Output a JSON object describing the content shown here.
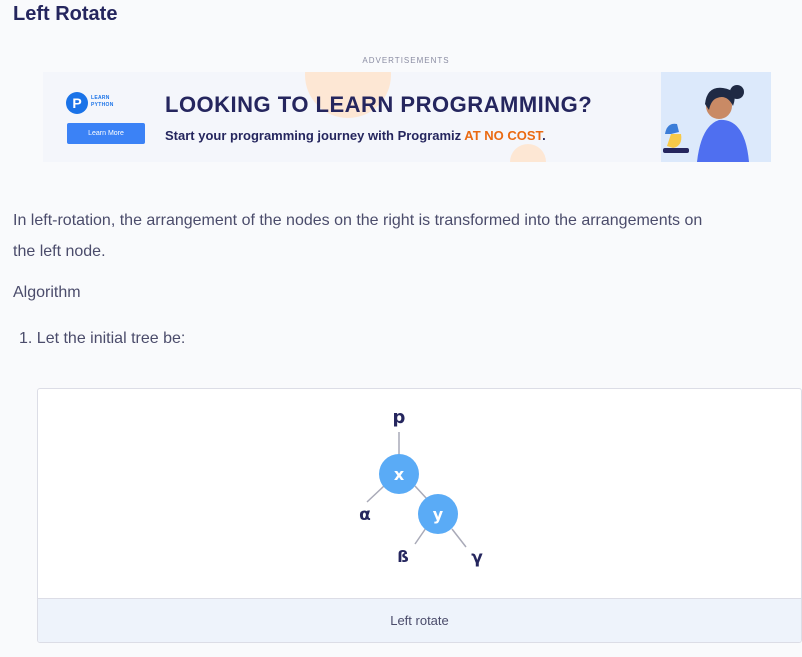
{
  "section": {
    "heading": "Left Rotate"
  },
  "ad": {
    "label": "ADVERTISEMENTS",
    "logo_line1": "LEARN",
    "logo_line2": "PYTHON",
    "button_label": "Learn More",
    "title": "LOOKING TO LEARN PROGRAMMING?",
    "subtitle": "Start your programming journey with Programiz",
    "subtitle_accent": "AT NO COST",
    "subtitle_end": ".",
    "accent_color": "#ea6a12"
  },
  "content": {
    "paragraph": "In left-rotation, the arrangement of the nodes on the right is transformed into the arrangements on the left node.",
    "algorithm_label": "Algorithm",
    "step1": "1. Let the initial tree be:"
  },
  "figure": {
    "labels": {
      "p": "p",
      "x": "x",
      "y": "y",
      "alpha": "α",
      "beta": "ß",
      "gamma": "γ"
    },
    "node_color": "#5aabf6",
    "caption": "Left rotate"
  }
}
